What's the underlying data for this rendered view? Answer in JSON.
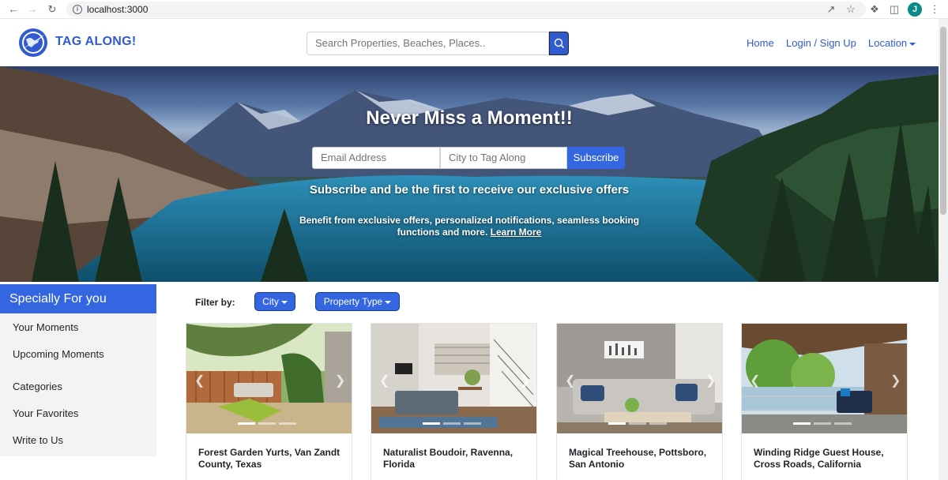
{
  "browser": {
    "url": "localhost:3000",
    "profile_initial": "J"
  },
  "navbar": {
    "brand": "TAG ALONG!",
    "search_placeholder": "Search Properties, Beaches, Places..",
    "links": [
      "Home",
      "Login / Sign Up",
      "Location"
    ]
  },
  "hero": {
    "title": "Never Miss a Moment!!",
    "email_placeholder": "Email Address",
    "city_placeholder": "City to Tag Along",
    "subscribe_label": "Subscribe",
    "subtitle": "Subscribe and be the first to receive our exclusive offers",
    "description": "Benefit from exclusive offers, personalized notifications, seamless booking functions and more.",
    "learn_more": "Learn More"
  },
  "sidebar": {
    "heading": "Specially For you",
    "items": [
      "Your Moments",
      "Upcoming Moments",
      "Categories",
      "Your Favorites",
      "Write to Us"
    ]
  },
  "filter": {
    "label": "Filter by:",
    "city_label": "City",
    "property_type_label": "Property Type"
  },
  "cards": [
    {
      "title": "Forest Garden Yurts, Van Zandt County, Texas"
    },
    {
      "title": "Naturalist Boudoir, Ravenna, Florida"
    },
    {
      "title": "Magical Treehouse, Pottsboro, San Antonio"
    },
    {
      "title": "Winding Ridge Guest House, Cross Roads, California"
    }
  ],
  "colors": {
    "brand": "#2f5bcf",
    "accent": "#3366e0"
  }
}
